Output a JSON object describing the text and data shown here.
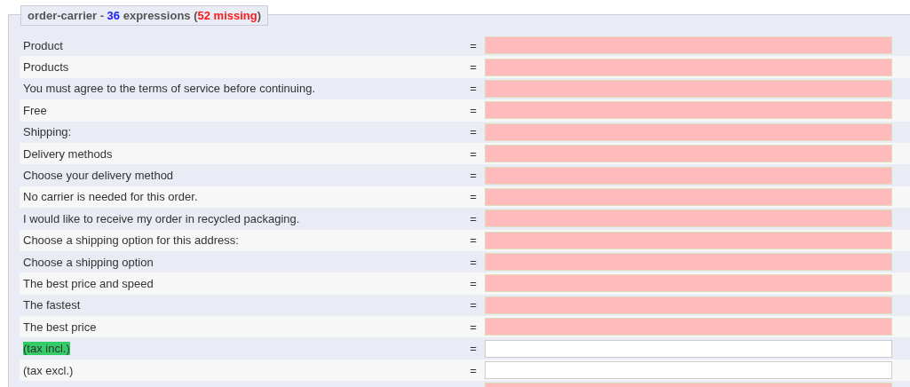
{
  "legend": [
    {
      "text": "order-carrier - ",
      "color": "#555555"
    },
    {
      "text": "36",
      "color": "#1a1aff"
    },
    {
      "text": " expressions (",
      "color": "#555555"
    },
    {
      "text": "52 missing",
      "color": "#ff1a1a"
    },
    {
      "text": ")",
      "color": "#555555"
    }
  ],
  "rows": [
    {
      "label": "Product",
      "sign": "=",
      "missing": true,
      "highlighted": false
    },
    {
      "label": "Products",
      "sign": "=",
      "missing": true,
      "highlighted": false
    },
    {
      "label": "You must agree to the terms of service before continuing.",
      "sign": "=",
      "missing": true,
      "highlighted": false
    },
    {
      "label": "Free",
      "sign": "=",
      "missing": true,
      "highlighted": false
    },
    {
      "label": "Shipping:",
      "sign": "=",
      "missing": true,
      "highlighted": false
    },
    {
      "label": "Delivery methods",
      "sign": "=",
      "missing": true,
      "highlighted": false
    },
    {
      "label": "Choose your delivery method",
      "sign": "=",
      "missing": true,
      "highlighted": false
    },
    {
      "label": "No carrier is needed for this order.",
      "sign": "=",
      "missing": true,
      "highlighted": false
    },
    {
      "label": "I would like to receive my order in recycled packaging.",
      "sign": "=",
      "missing": true,
      "highlighted": false
    },
    {
      "label": "Choose a shipping option for this address:",
      "sign": "=",
      "missing": true,
      "highlighted": false
    },
    {
      "label": "Choose a shipping option",
      "sign": "=",
      "missing": true,
      "highlighted": false
    },
    {
      "label": "The best price and speed",
      "sign": "=",
      "missing": true,
      "highlighted": false
    },
    {
      "label": "The fastest",
      "sign": "=",
      "missing": true,
      "highlighted": false
    },
    {
      "label": "The best price",
      "sign": "=",
      "missing": true,
      "highlighted": false
    },
    {
      "label": "(tax incl.)",
      "sign": "=",
      "missing": false,
      "highlighted": true
    },
    {
      "label": "(tax excl.)",
      "sign": "=",
      "missing": false,
      "highlighted": false
    },
    {
      "missing": true
    }
  ]
}
